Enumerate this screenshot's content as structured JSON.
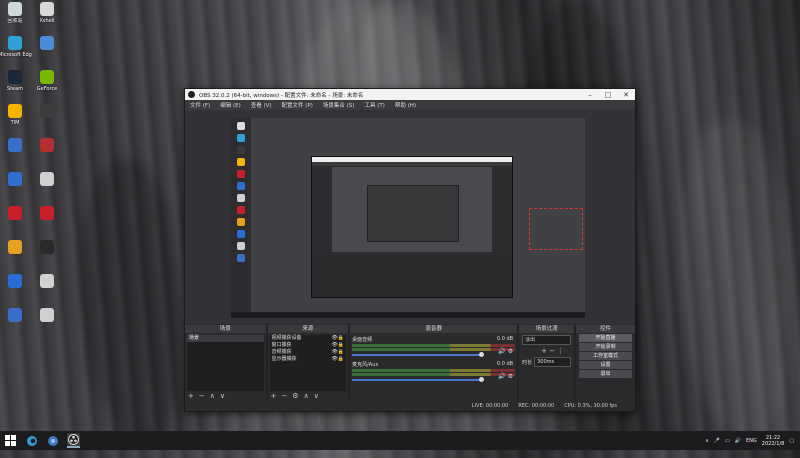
{
  "desktop": {
    "icons": [
      {
        "label": "回收站",
        "color": "#cfd6dc"
      },
      {
        "label": "Xshell",
        "color": "#d8d8d8"
      },
      {
        "label": "Microsoft Edge",
        "color": "#2fa0d8"
      },
      {
        "label": "",
        "color": "#4a8dd6"
      },
      {
        "label": "Steam",
        "color": "#1b2838"
      },
      {
        "label": "GeForce",
        "color": "#76b900"
      },
      {
        "label": "TIM",
        "color": "#f5b400"
      },
      {
        "label": "",
        "color": "#3c3c3c"
      },
      {
        "label": "",
        "color": "#3a6ec8"
      },
      {
        "label": "",
        "color": "#b03030"
      },
      {
        "label": "",
        "color": "#2f6fd0"
      },
      {
        "label": "",
        "color": "#d0d0d0"
      },
      {
        "label": "",
        "color": "#c8202a"
      },
      {
        "label": "",
        "color": "#c8202a"
      },
      {
        "label": "",
        "color": "#e8a020"
      },
      {
        "label": "",
        "color": "#2a2a2a"
      },
      {
        "label": "",
        "color": "#2a6cd6"
      },
      {
        "label": "",
        "color": "#d0d0d0"
      },
      {
        "label": "",
        "color": "#3a6ec8"
      },
      {
        "label": "",
        "color": "#d0d0d0"
      }
    ]
  },
  "obs": {
    "window_title": "OBS 32.0.2 (64-bit, windows) - 配置文件: 未命名 - 场景: 未命名",
    "menu": [
      "文件 (F)",
      "编辑 (E)",
      "查看 (V)",
      "配置文件 (P)",
      "场景集合 (S)",
      "工具 (T)",
      "帮助 (H)"
    ],
    "docks": {
      "scenes": {
        "title": "场景",
        "items": [
          "场景"
        ]
      },
      "sources": {
        "title": "来源",
        "items": [
          "视频捕获设备",
          "窗口捕获",
          "音频捕获",
          "显示器捕获"
        ]
      },
      "mixer": {
        "title": "混音器",
        "rows": [
          {
            "name": "桌面音频",
            "db": "0.0 dB",
            "level": 0.72
          },
          {
            "name": "麦克风/Aux",
            "db": "0.0 dB",
            "level": 0.55
          }
        ]
      },
      "transitions": {
        "title": "场景过渡",
        "selected": "淡出",
        "duration_label": "时长",
        "duration": "300ms"
      },
      "controls": {
        "title": "控件",
        "buttons": [
          "开始直播",
          "开始录制",
          "工作室模式",
          "设置",
          "退出"
        ]
      }
    },
    "status": {
      "live": "LIVE: 00:00:00",
      "rec": "REC: 00:00:00",
      "cpu": "CPU: 0.3%, 30.00 fps"
    }
  },
  "taskbar": {
    "lang": "ENG",
    "time": "21:22",
    "date": "2022/1/8"
  }
}
